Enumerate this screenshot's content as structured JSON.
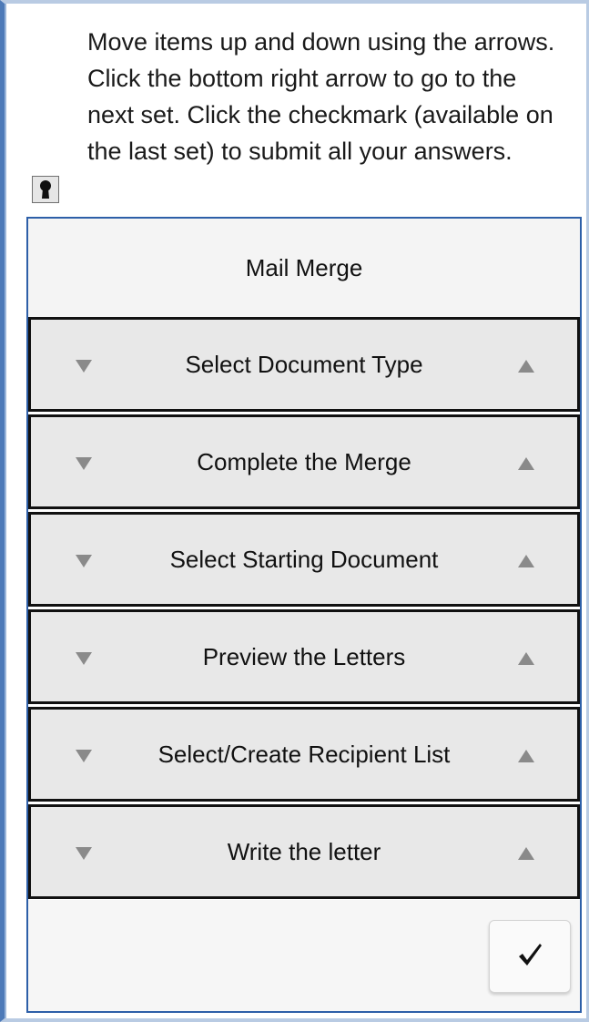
{
  "instructions": "Move items up and down using the arrows. Click the bottom right arrow to go to the next set. Click the checkmark (available on the last set) to submit all your answers.",
  "icons": {
    "lock": "keyhole-lock-icon",
    "move_down": "triangle-down-icon",
    "move_up": "triangle-up-icon",
    "submit": "checkmark-icon"
  },
  "panel": {
    "title": "Mail Merge",
    "items": [
      {
        "label": "Select Document Type"
      },
      {
        "label": "Complete the Merge"
      },
      {
        "label": "Select Starting Document"
      },
      {
        "label": "Preview the Letters"
      },
      {
        "label": "Select/Create Recipient List"
      },
      {
        "label": "Write the letter"
      }
    ]
  },
  "colors": {
    "frame_accent": "#4d7ab8",
    "panel_border": "#2d5fa8",
    "item_background": "#e8e8e8",
    "arrow": "#8a8a8a"
  }
}
